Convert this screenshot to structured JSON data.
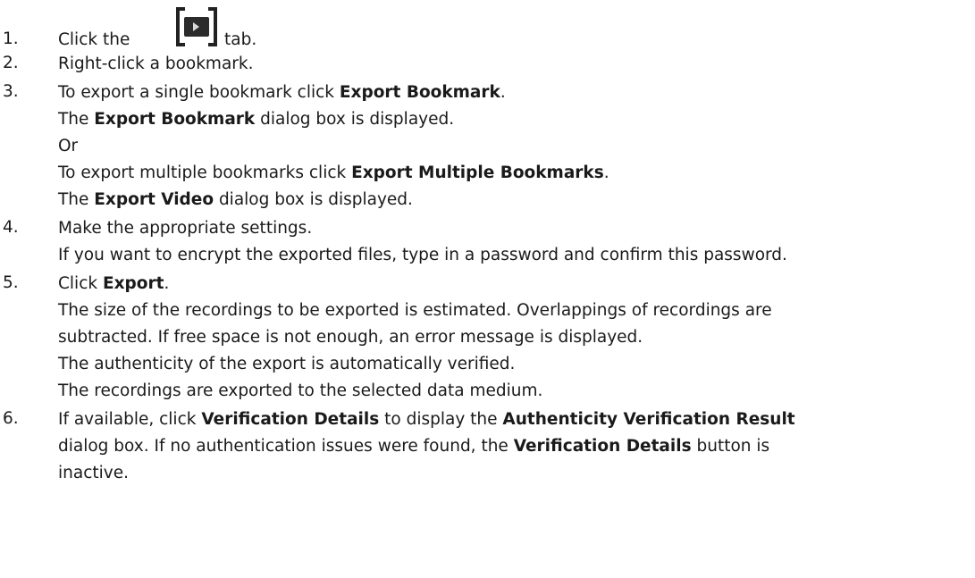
{
  "steps": [
    {
      "number": "1.",
      "pre": "Click the",
      "icon": "bookmark-tab-icon",
      "post": "tab."
    },
    {
      "number": "2.",
      "text": "Right-click a bookmark."
    },
    {
      "number": "3.",
      "l1_pre": "To export a single bookmark click ",
      "l1_bold": "Export Bookmark",
      "l1_post": ".",
      "l2_pre": "The ",
      "l2_bold": "Export Bookmark",
      "l2_post": " dialog box is displayed.",
      "l3": "Or",
      "l4_pre": "To export multiple bookmarks click ",
      "l4_bold": "Export Multiple Bookmarks",
      "l4_post": ".",
      "l5_pre": "The ",
      "l5_bold": "Export Video",
      "l5_post": " dialog box is displayed."
    },
    {
      "number": "4.",
      "l1": "Make the appropriate settings.",
      "l2": "If you want to encrypt the exported files, type in a password and confirm this password."
    },
    {
      "number": "5.",
      "l1_pre": "Click ",
      "l1_bold": "Export",
      "l1_post": ".",
      "l2": "The size of the recordings to be exported is estimated. Overlappings of recordings are",
      "l3": "subtracted. If free space is not enough, an error message is displayed.",
      "l4": "The authenticity of the export is automatically verified.",
      "l5": "The recordings are exported to the selected data medium."
    },
    {
      "number": "6.",
      "l1_pre": "If available, click ",
      "l1_bold": "Verification Details",
      "l1_mid": " to display the ",
      "l1_bold2": "Authenticity Verification Result",
      "l2_pre": "dialog box. If no authentication issues were found, the ",
      "l2_bold": "Verification Details",
      "l2_post": " button is",
      "l3": "inactive."
    }
  ]
}
